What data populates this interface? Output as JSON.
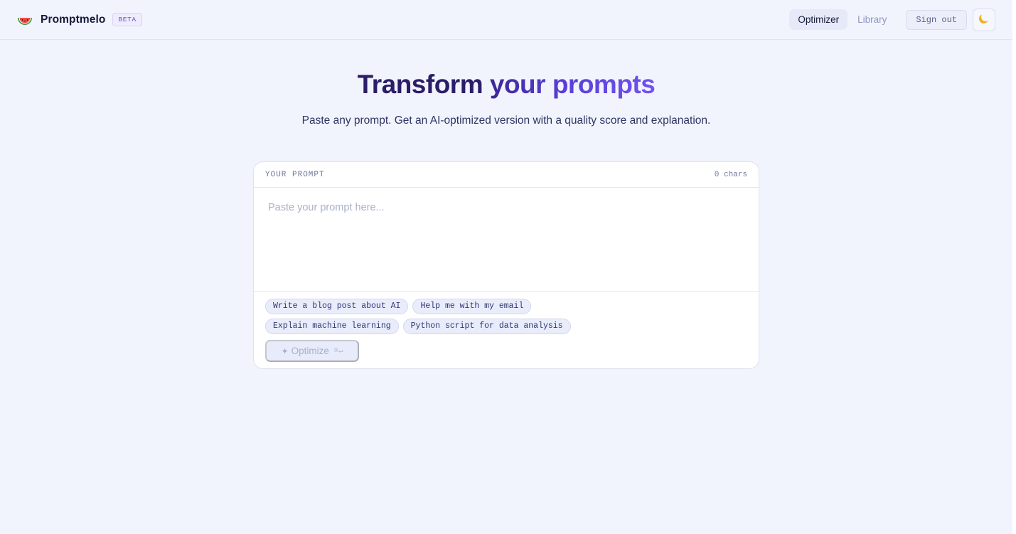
{
  "app": {
    "brand_name": "Promptmelo",
    "badge": "BETA",
    "logo_icon": "watermelon-icon"
  },
  "nav": {
    "items": [
      {
        "label": "Optimizer",
        "active": true
      },
      {
        "label": "Library",
        "active": false
      }
    ],
    "sign_out_label": "Sign out",
    "theme_toggle_icon": "moon-icon"
  },
  "hero": {
    "title_part1": "Transform ",
    "title_part2": "your prompts",
    "subtitle": "Paste any prompt. Get an AI-optimized version with a quality score and explanation."
  },
  "prompt_card": {
    "label": "YOUR PROMPT",
    "char_count": "0 chars",
    "input_value": "",
    "placeholder": "Paste your prompt here...",
    "suggestions": [
      "Write a blog post about AI",
      "Help me with my email",
      "Explain machine learning",
      "Python script for data analysis"
    ],
    "optimize_label": "Optimize",
    "optimize_icon": "sparkle-icon",
    "optimize_shortcut": "⌘↵",
    "optimize_enabled": false
  },
  "colors": {
    "background": "#f1f4fd",
    "accent": "#5a3ed6",
    "title": "#2c1d69"
  }
}
